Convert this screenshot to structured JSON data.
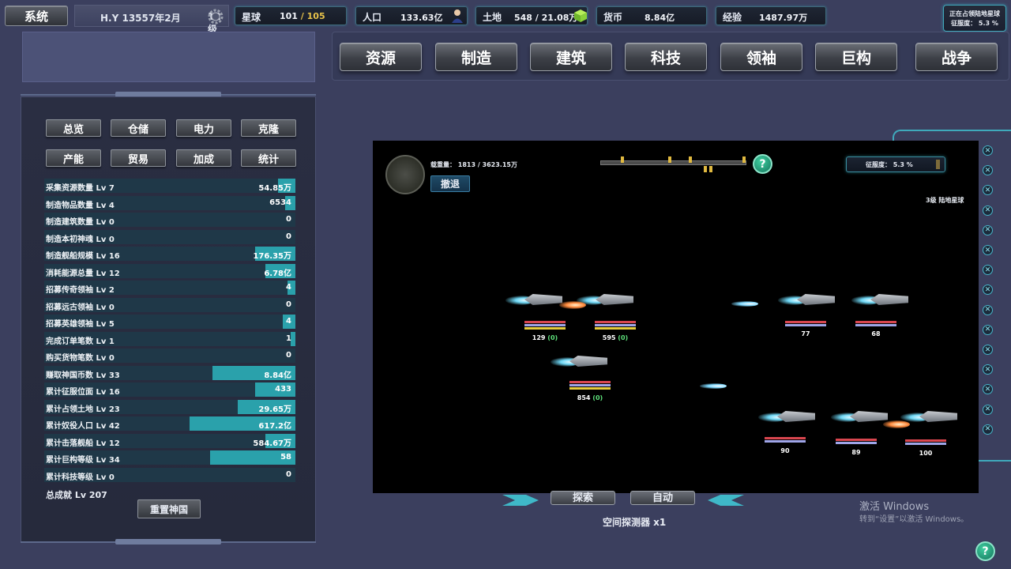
{
  "topbar": {
    "system_label": "系统",
    "date": "H.Y 13557年2月",
    "level": "12级",
    "planet": {
      "label": "星球",
      "current": "101",
      "sep": " / ",
      "total": "105"
    },
    "population": {
      "label": "人口",
      "value": "133.63亿"
    },
    "land": {
      "label": "土地",
      "value": "548 / 21.08万"
    },
    "currency": {
      "label": "货币",
      "value": "8.84亿"
    },
    "experience": {
      "label": "经验",
      "value": "1487.97万"
    },
    "conquering": {
      "title": "正在占领陆地星球",
      "progress": "征服度： 5.3 %"
    }
  },
  "nav": [
    "资源",
    "制造",
    "建筑",
    "科技",
    "领袖",
    "巨构",
    "战争"
  ],
  "left_tabs": [
    "总览",
    "仓储",
    "电力",
    "克隆",
    "产能",
    "贸易",
    "加成",
    "统计"
  ],
  "stats": [
    {
      "name": "采集资源数量  Lv 7",
      "value": "54.85万",
      "fill": 0.07
    },
    {
      "name": "制造物品数量  Lv 4",
      "value": "6534",
      "fill": 0.04
    },
    {
      "name": "制造建筑数量  Lv 0",
      "value": "0",
      "fill": 0
    },
    {
      "name": "制造本初神魂  Lv 0",
      "value": "0",
      "fill": 0
    },
    {
      "name": "制造舰船规模  Lv 16",
      "value": "176.35万",
      "fill": 0.16
    },
    {
      "name": "消耗能源总量  Lv 12",
      "value": "6.78亿",
      "fill": 0.12
    },
    {
      "name": "招募传奇领袖  Lv 2",
      "value": "4",
      "fill": 0.03
    },
    {
      "name": "招募远古领袖  Lv 0",
      "value": "0",
      "fill": 0
    },
    {
      "name": "招募英雄领袖  Lv 5",
      "value": "4",
      "fill": 0.05
    },
    {
      "name": "完成订单笔数  Lv 1",
      "value": "1",
      "fill": 0.02
    },
    {
      "name": "购买货物笔数  Lv 0",
      "value": "0",
      "fill": 0
    },
    {
      "name": "赚取神国币数  Lv 33",
      "value": "8.84亿",
      "fill": 0.33
    },
    {
      "name": "累计征服位面  Lv 16",
      "value": "433",
      "fill": 0.16
    },
    {
      "name": "累计占领土地  Lv 23",
      "value": "29.65万",
      "fill": 0.23
    },
    {
      "name": "累计奴役人口  Lv 42",
      "value": "617.2亿",
      "fill": 0.42
    },
    {
      "name": "累计击落舰船  Lv 12",
      "value": "584.67万",
      "fill": 0.12
    },
    {
      "name": "累计巨构等级  Lv 34",
      "value": "58",
      "fill": 0.34
    },
    {
      "name": "累计科技等级  Lv 0",
      "value": "0",
      "fill": 0
    }
  ],
  "total_achievement": "总成就 Lv 207",
  "reset_label": "重置神国",
  "battle": {
    "load": "载重量： 1813 / 3623.15万",
    "retreat": "撤退",
    "conquest": "征服度： 5.3 %",
    "planet": "3级 陆地星球",
    "units": [
      {
        "hp": "129",
        "extra": "(0)"
      },
      {
        "hp": "595",
        "extra": "(0)"
      },
      {
        "hp": "854",
        "extra": "(0)"
      },
      {
        "hp": "77"
      },
      {
        "hp": "68"
      },
      {
        "hp": "90"
      },
      {
        "hp": "89"
      },
      {
        "hp": "100"
      }
    ]
  },
  "bottom": {
    "explore": "探索",
    "auto": "自动",
    "probe": "空间探测器 x1"
  },
  "watermark": {
    "title": "激活 Windows",
    "sub": "转到“设置”以激活 Windows。"
  },
  "help": "?",
  "colors": {
    "bg": "#3b3f5e",
    "accent": "#3fa9bb",
    "stat_fill": "#2aa1ab",
    "gold": "#e7c24a"
  }
}
